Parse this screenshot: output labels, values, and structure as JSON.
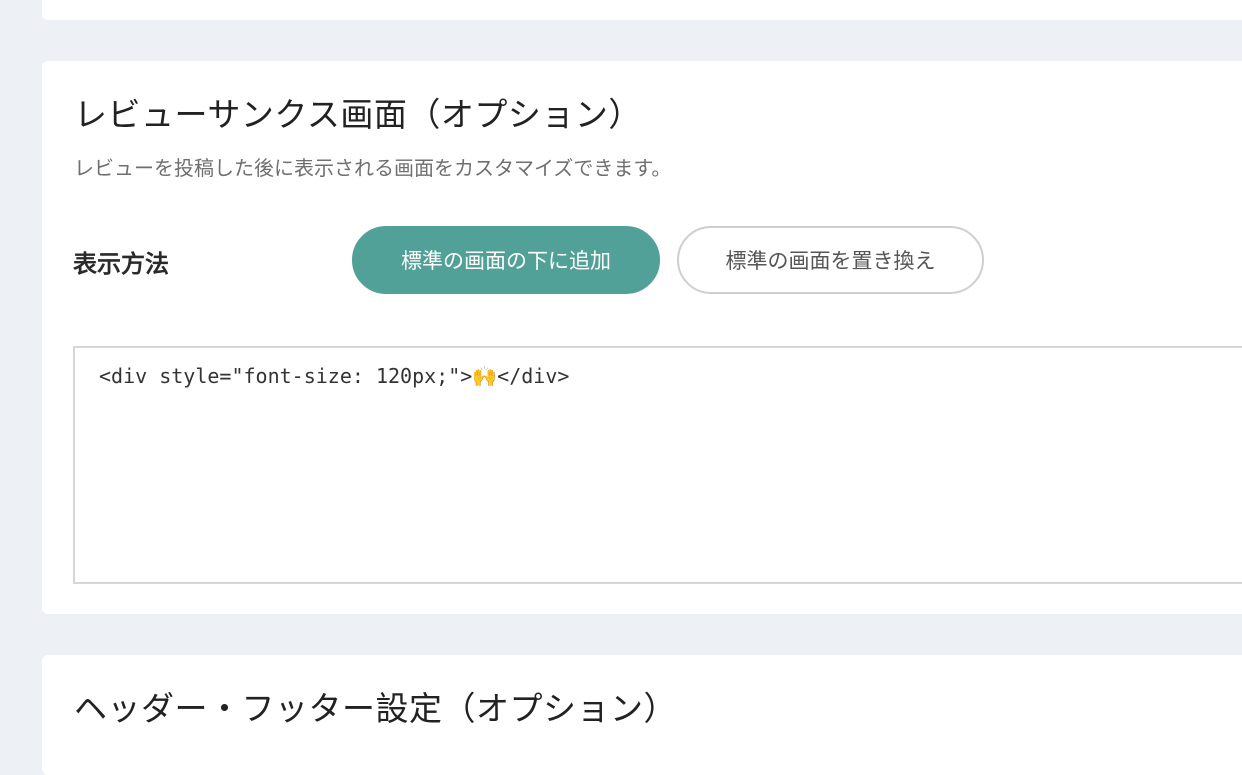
{
  "review_thanks": {
    "title": "レビューサンクス画面（オプション）",
    "description": "レビューを投稿した後に表示される画面をカスタマイズできます。",
    "display_method": {
      "label": "表示方法",
      "options": [
        {
          "label": "標準の画面の下に追加",
          "selected": true
        },
        {
          "label": "標準の画面を置き換え",
          "selected": false
        }
      ]
    },
    "html_code": "<div style=\"font-size: 120px;\">🙌</div>"
  },
  "header_footer": {
    "title": "ヘッダー・フッター設定（オプション）"
  },
  "colors": {
    "background": "#edf0f4",
    "card": "#ffffff",
    "accent": "#52a199",
    "inactive_border": "#cfcfcf"
  }
}
